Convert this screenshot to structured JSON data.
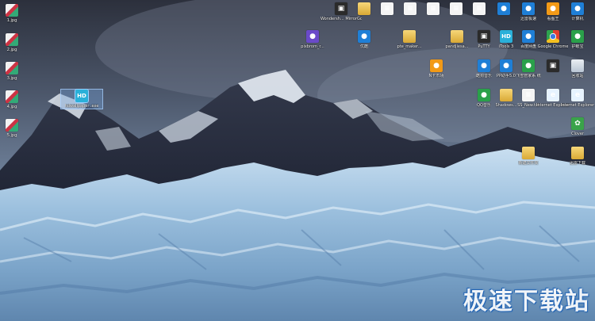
{
  "desktop": {
    "watermark": "极速下载站",
    "icons": [
      {
        "label": "1.jpg",
        "kind": "img",
        "sel": false
      },
      {
        "label": "2.jpg",
        "kind": "img",
        "sel": false
      },
      {
        "label": "3.jpg",
        "kind": "img",
        "sel": false
      },
      {
        "label": "4.jpg",
        "kind": "img",
        "sel": false
      },
      {
        "label": "5.jpg",
        "kind": "img",
        "sel": false
      },
      {
        "label": "Wondersh... MirrorGo",
        "kind": "dark",
        "sel": false
      },
      {
        "label": "",
        "kind": "folder",
        "sel": false
      },
      {
        "label": "",
        "kind": "file",
        "sel": false
      },
      {
        "label": "",
        "kind": "file",
        "sel": false
      },
      {
        "label": "",
        "kind": "file",
        "sel": false
      },
      {
        "label": "",
        "kind": "file",
        "sel": false
      },
      {
        "label": "",
        "kind": "file",
        "sel": false
      },
      {
        "label": "",
        "kind": "blue",
        "sel": false
      },
      {
        "label": "迅雷极速",
        "kind": "blue",
        "sel": false
      },
      {
        "label": "看图王",
        "kind": "orange",
        "sel": false
      },
      {
        "label": "计算机",
        "kind": "blue",
        "sel": false
      },
      {
        "label": "pixbrom_r...",
        "kind": "purple",
        "sel": false
      },
      {
        "label": "优酷",
        "kind": "blue",
        "sel": false
      },
      {
        "label": "pte_maker...",
        "kind": "folder",
        "sel": false
      },
      {
        "label": "pandjiesa...",
        "kind": "folder",
        "sel": false
      },
      {
        "label": "PuTTY",
        "kind": "dark",
        "sel": false
      },
      {
        "label": "iTools 3",
        "kind": "cyan",
        "sel": false
      },
      {
        "label": "百度网盘",
        "kind": "blue",
        "sel": false
      },
      {
        "label": "Google Chrome",
        "kind": "chrome",
        "sel": false
      },
      {
        "label": "护眼宝",
        "kind": "green",
        "sel": false
      },
      {
        "label": "hdwallpaper .exe",
        "kind": "cyan",
        "sel": true
      },
      {
        "label": "N卡市场",
        "kind": "orange",
        "sel": false
      },
      {
        "label": "酷狗音乐",
        "kind": "blue",
        "sel": false
      },
      {
        "label": "PP助手5.0",
        "kind": "blue",
        "sel": false
      },
      {
        "label": "飞雪管家系 统",
        "kind": "green",
        "sel": false
      },
      {
        "label": "",
        "kind": "dark",
        "sel": false
      },
      {
        "label": "回收站",
        "kind": "bin",
        "sel": false
      },
      {
        "label": "QQ音乐",
        "kind": "green",
        "sel": false
      },
      {
        "label": "Shadows...",
        "kind": "folder",
        "sel": false
      },
      {
        "label": "SS_New.txt",
        "kind": "file",
        "sel": false
      },
      {
        "label": "Internet Explorer",
        "kind": "ie",
        "sel": false
      },
      {
        "label": "Internet Explorer",
        "kind": "ie",
        "sel": false
      },
      {
        "label": "Clover",
        "kind": "clover",
        "sel": false
      },
      {
        "label": "新建文件夹",
        "kind": "folder",
        "sel": false
      },
      {
        "label": "迅雷下载",
        "kind": "folder",
        "sel": false
      }
    ]
  }
}
